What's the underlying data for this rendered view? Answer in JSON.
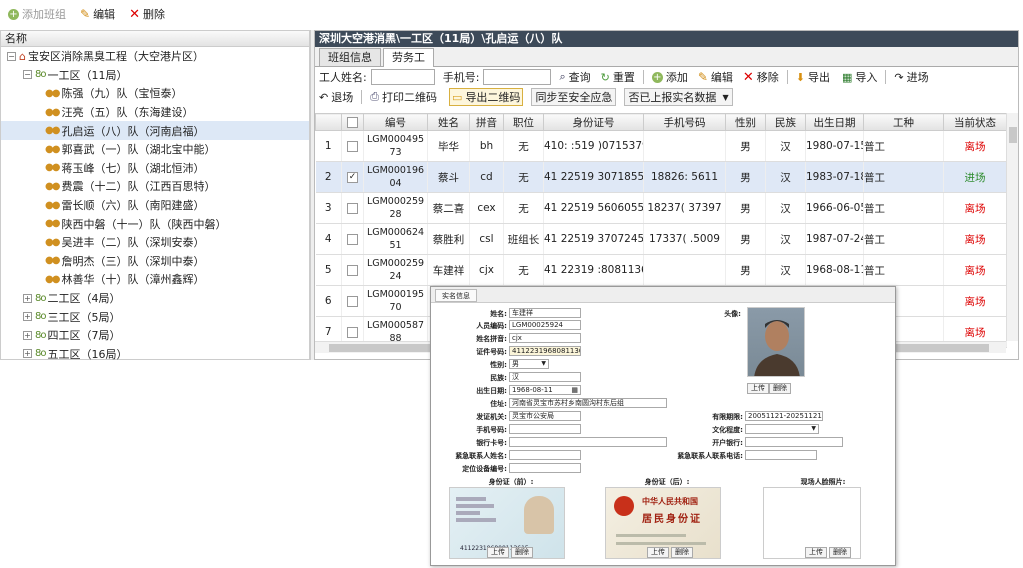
{
  "toolbar": {
    "add_group": "添加班组",
    "edit": "编辑",
    "delete": "删除"
  },
  "tree": {
    "header": "名称",
    "nodes": [
      {
        "label": "宝安区消除黑臭工程（大空港片区）",
        "level": 0,
        "kind": "root",
        "toggle": "⊟",
        "selected": false
      },
      {
        "label": "一工区（11局）",
        "level": 1,
        "kind": "group",
        "toggle": "⊟",
        "selected": false
      },
      {
        "label": "陈强（九）队（宝恒泰）",
        "level": 2,
        "kind": "team",
        "toggle": "",
        "selected": false
      },
      {
        "label": "汪亮（五）队（东海建设）",
        "level": 2,
        "kind": "team",
        "toggle": "",
        "selected": false
      },
      {
        "label": "孔启运（八）队（河南启福）",
        "level": 2,
        "kind": "team",
        "toggle": "",
        "selected": true
      },
      {
        "label": "郭喜武（一）队（湖北宝中能）",
        "level": 2,
        "kind": "team",
        "toggle": "",
        "selected": false
      },
      {
        "label": "蒋玉峰（七）队（湖北恒沛）",
        "level": 2,
        "kind": "team",
        "toggle": "",
        "selected": false
      },
      {
        "label": "费震（十二）队（江西百思特）",
        "level": 2,
        "kind": "team",
        "toggle": "",
        "selected": false
      },
      {
        "label": "雷长顺（六）队（南阳建盛）",
        "level": 2,
        "kind": "team",
        "toggle": "",
        "selected": false
      },
      {
        "label": "陕西中磐（十一）队（陕西中磐）",
        "level": 2,
        "kind": "team",
        "toggle": "",
        "selected": false
      },
      {
        "label": "吴进丰（二）队（深圳安泰）",
        "level": 2,
        "kind": "team",
        "toggle": "",
        "selected": false
      },
      {
        "label": "詹明杰（三）队（深圳中泰）",
        "level": 2,
        "kind": "team",
        "toggle": "",
        "selected": false
      },
      {
        "label": "林善华（十）队（漳州鑫辉）",
        "level": 2,
        "kind": "team",
        "toggle": "",
        "selected": false
      },
      {
        "label": "二工区（4局）",
        "level": 1,
        "kind": "group",
        "toggle": "⊞",
        "selected": false
      },
      {
        "label": "三工区（5局）",
        "level": 1,
        "kind": "group",
        "toggle": "⊞",
        "selected": false
      },
      {
        "label": "四工区（7局）",
        "level": 1,
        "kind": "group",
        "toggle": "⊞",
        "selected": false
      },
      {
        "label": "五工区（16局）",
        "level": 1,
        "kind": "group",
        "toggle": "⊞",
        "selected": false
      }
    ]
  },
  "panel": {
    "title": "深圳大空港消黑\\一工区（11局）\\孔启运（八）队",
    "tabs": [
      {
        "label": "班组信息",
        "active": false
      },
      {
        "label": "劳务工",
        "active": true
      }
    ],
    "filter": {
      "name_label": "工人姓名:",
      "phone_label": "手机号:",
      "search": "查询",
      "reset": "重置",
      "add": "添加",
      "edit": "编辑",
      "remove": "移除",
      "export": "导出",
      "import": "导入",
      "enter": "进场"
    },
    "toolbar2": {
      "exit": "退场",
      "print_qr": "打印二维码",
      "export_qr": "导出二维码",
      "sync": "同步至安全应急",
      "realname": "否已上报实名数据"
    }
  },
  "grid": {
    "columns": [
      "",
      "",
      "编号",
      "姓名",
      "拼音",
      "职位",
      "身份证号",
      "手机号码",
      "性别",
      "民族",
      "出生日期",
      "工种",
      "当前状态"
    ],
    "rows": [
      {
        "num": "1",
        "checked": false,
        "selected": false,
        "code": "LGM00049573",
        "name": "毕华",
        "pinyin": "bh",
        "role": "无",
        "idno": "410: :519  )0715379X",
        "phone": "",
        "gender": "男",
        "ethnic": "汉",
        "birth": "1980-07-15",
        "trade": "普工",
        "status": "离场",
        "status_type": "red"
      },
      {
        "num": "2",
        "checked": true,
        "selected": true,
        "code": "LGM00019604",
        "name": "蔡斗",
        "pinyin": "cd",
        "role": "无",
        "idno": "41  22519  307185515",
        "phone": "18826:  5611",
        "gender": "男",
        "ethnic": "汉",
        "birth": "1983-07-18",
        "trade": "普工",
        "status": "进场",
        "status_type": "green"
      },
      {
        "num": "3",
        "checked": false,
        "selected": false,
        "code": "LGM00025928",
        "name": "蔡二喜",
        "pinyin": "cex",
        "role": "无",
        "idno": "41  22519  5606055519",
        "phone": "18237( 37397",
        "gender": "男",
        "ethnic": "汉",
        "birth": "1966-06-05",
        "trade": "普工",
        "status": "离场",
        "status_type": "red"
      },
      {
        "num": "4",
        "checked": false,
        "selected": false,
        "code": "LGM00062451",
        "name": "蔡胜利",
        "pinyin": "csl",
        "role": "班组长",
        "idno": "41  22519  3707245513",
        "phone": "17337( .5009",
        "gender": "男",
        "ethnic": "汉",
        "birth": "1987-07-24",
        "trade": "普工",
        "status": "离场",
        "status_type": "red"
      },
      {
        "num": "5",
        "checked": false,
        "selected": false,
        "code": "LGM00025924",
        "name": "车建祥",
        "pinyin": "cjx",
        "role": "无",
        "idno": "41  22319  :808113615",
        "phone": "",
        "gender": "男",
        "ethnic": "汉",
        "birth": "1968-08-11",
        "trade": "普工",
        "status": "离场",
        "status_type": "red"
      },
      {
        "num": "6",
        "checked": false,
        "selected": false,
        "code": "LGM00019570",
        "name": "",
        "pinyin": "",
        "role": "",
        "idno": "",
        "phone": "",
        "gender": "",
        "ethnic": "",
        "birth": "",
        "trade": "",
        "status": "离场",
        "status_type": "red"
      },
      {
        "num": "7",
        "checked": false,
        "selected": false,
        "code": "LGM00058788",
        "name": "",
        "pinyin": "",
        "role": "",
        "idno": "",
        "phone": "",
        "gender": "",
        "ethnic": "",
        "birth": "",
        "trade": "",
        "status": "离场",
        "status_type": "red"
      }
    ]
  },
  "popup": {
    "tab": "实名信息",
    "labels": {
      "name": "姓名:",
      "code": "人员编码:",
      "pinyin": "姓名拼音:",
      "idno": "证件号码:",
      "gender": "性别:",
      "ethnic": "民族:",
      "birth": "出生日期:",
      "address": "住址:",
      "issuer": "发证机关:",
      "phone": "手机号码:",
      "bankcard": "银行卡号:",
      "emergency_name": "紧急联系人姓名:",
      "device": "定位设备编号:",
      "avatar": "头像:",
      "validity": "有限期限:",
      "education": "文化程度:",
      "bank": "开户银行:",
      "emergency_phone": "紧急联系人联系电话:",
      "id_front": "身份证（前）:",
      "id_back": "身份证（后）:",
      "face": "现场人脸照片:"
    },
    "values": {
      "name": "车建祥",
      "code": "LGM00025924",
      "pinyin": "cjx",
      "idno": "411223196808113615",
      "gender": "男",
      "ethnic": "汉",
      "birth": "1968-08-11",
      "address": "河南省灵宝市苏村乡南圆沟村东后组",
      "issuer": "灵宝市公安局",
      "validity": "20051121-20251121"
    },
    "buttons": {
      "upload": "上传",
      "delete": "删除"
    },
    "idcard_back": {
      "line1": "中华人民共和国",
      "line2": "居民身份证"
    }
  }
}
